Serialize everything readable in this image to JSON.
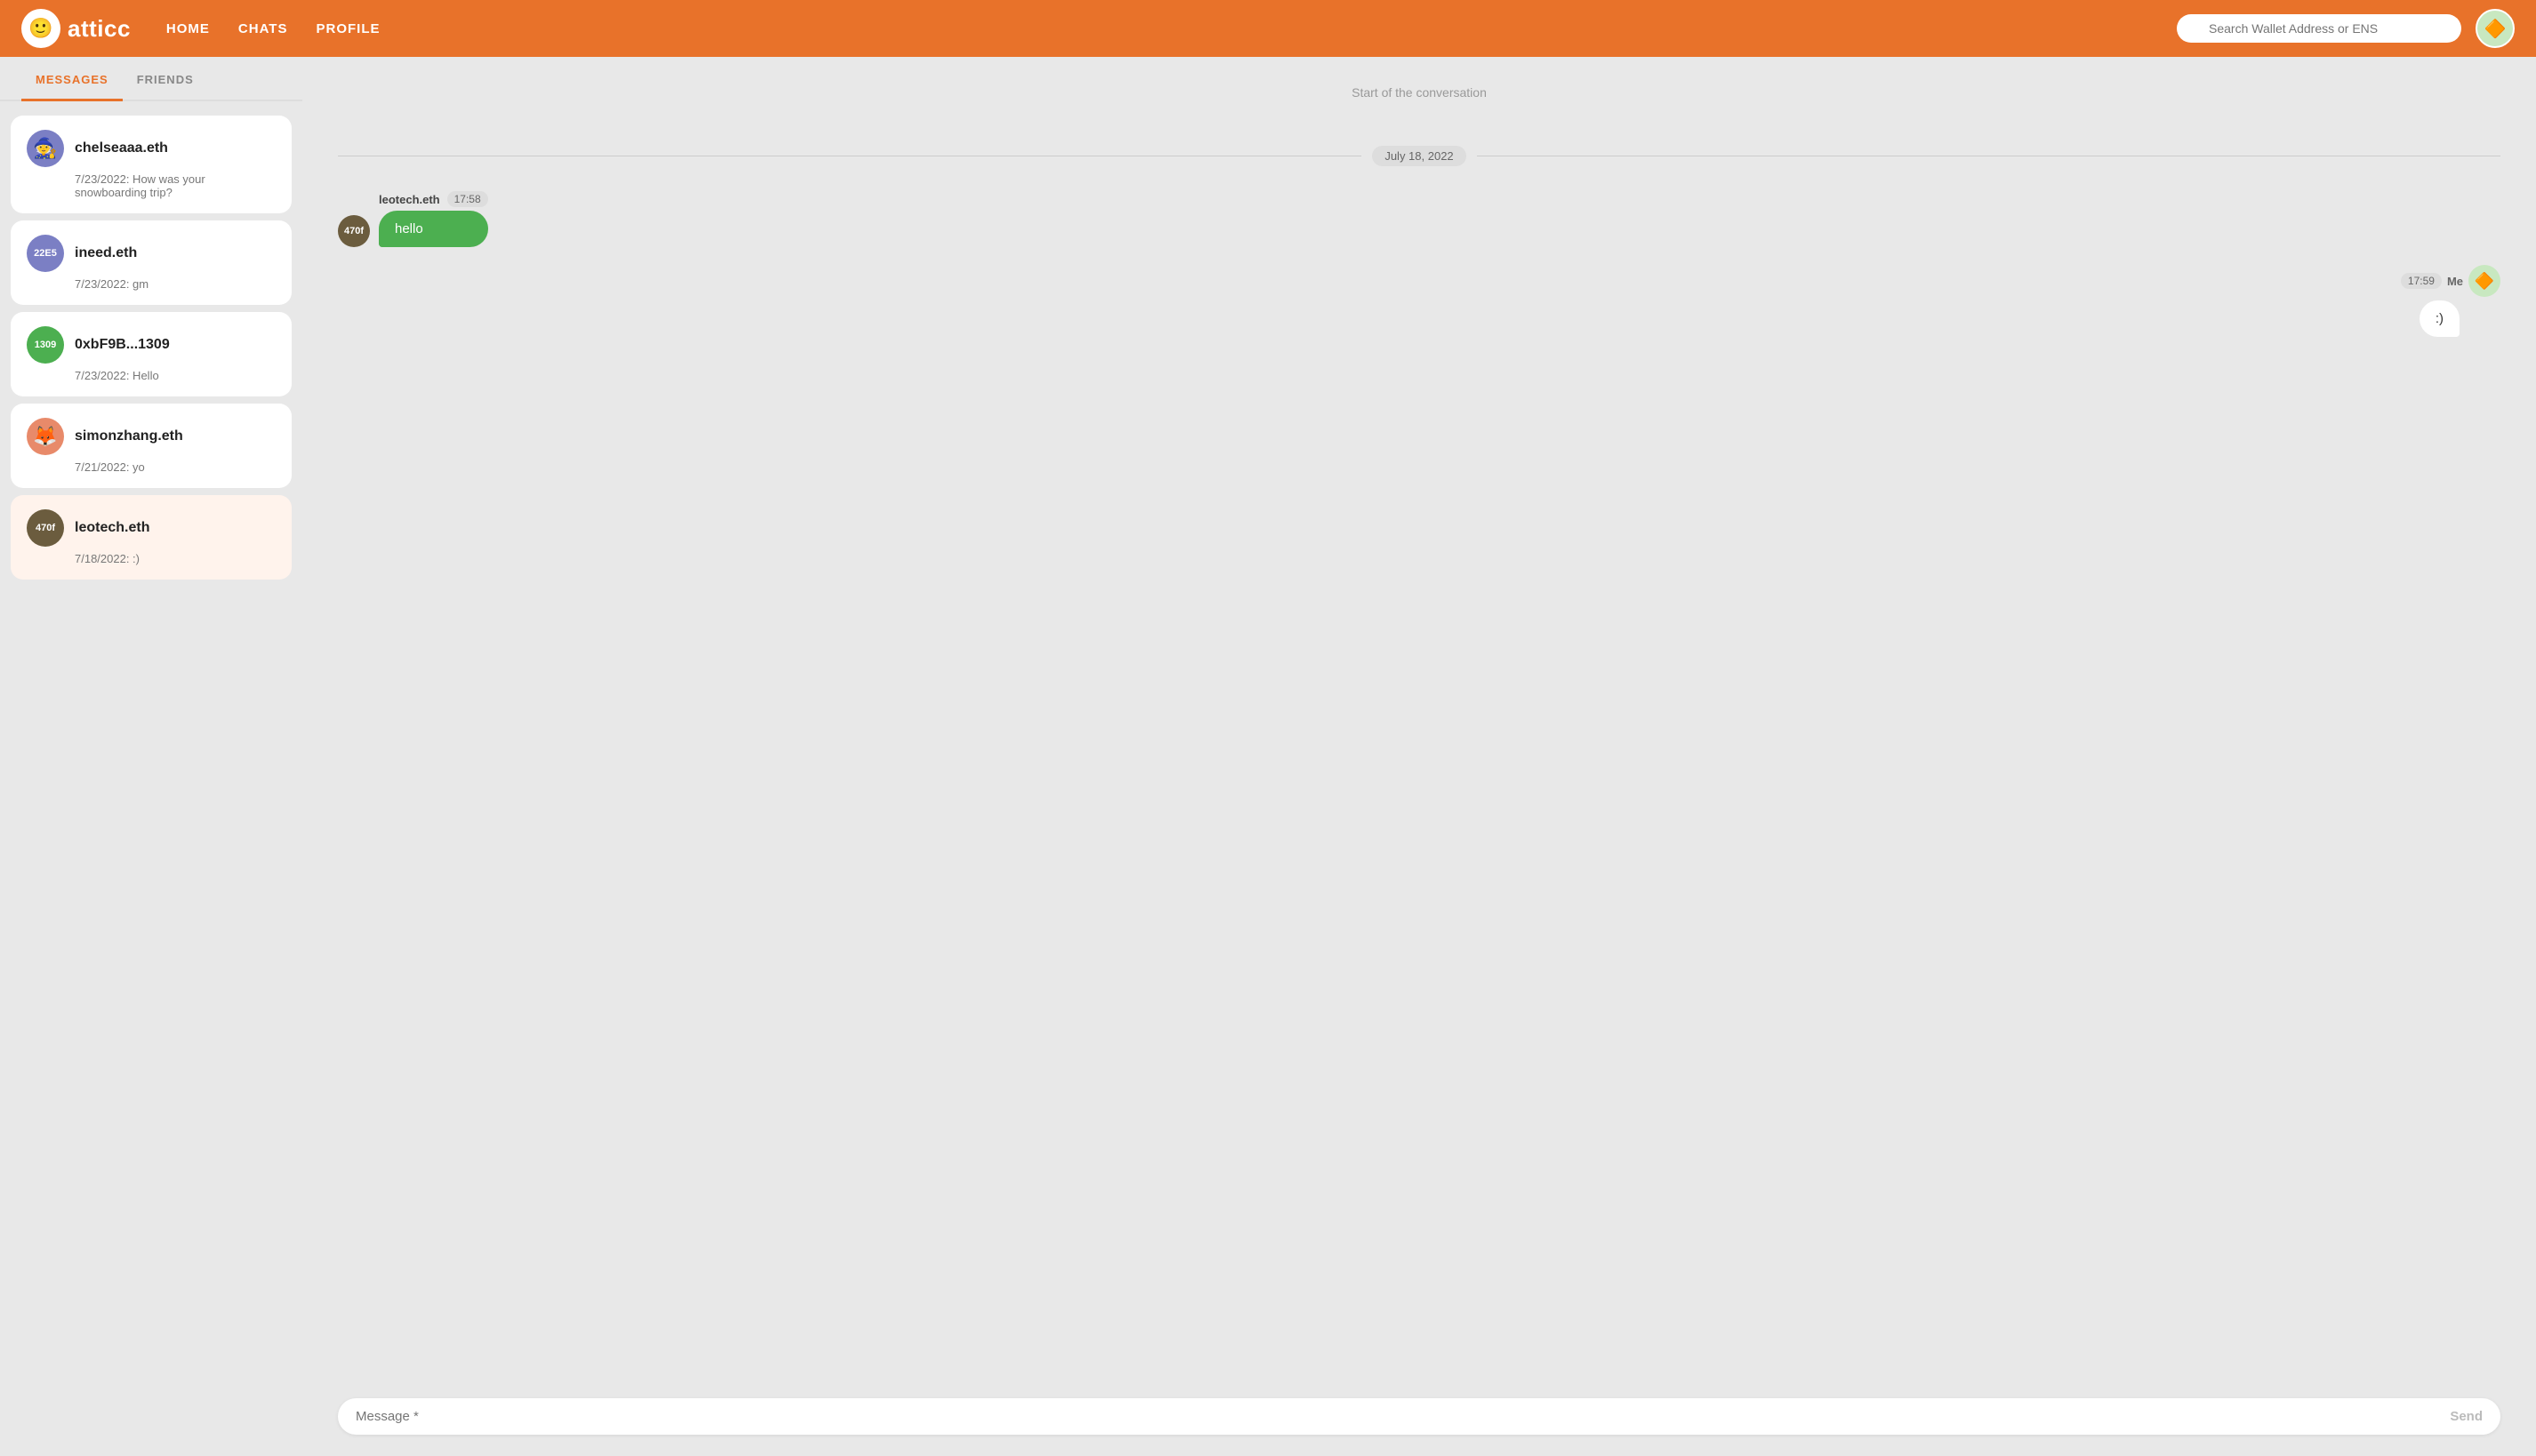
{
  "app": {
    "logo_icon": "🙂",
    "logo_text": "atticc"
  },
  "navbar": {
    "home_label": "HOME",
    "chats_label": "CHATS",
    "profile_label": "PROFILE",
    "search_placeholder": "Search Wallet Address or ENS",
    "user_avatar_icon": "🔶"
  },
  "tabs": {
    "messages_label": "MESSAGES",
    "friends_label": "FRIENDS"
  },
  "conversations": [
    {
      "id": "chelseaaa",
      "name": "chelseaaa.eth",
      "preview": "7/23/2022: How was your snowboarding trip?",
      "avatar_type": "image",
      "avatar_color": "#7b7fc4",
      "avatar_initials": "",
      "avatar_emoji": "🧙"
    },
    {
      "id": "ineed",
      "name": "ineed.eth",
      "preview": "7/23/2022: gm",
      "avatar_type": "initials",
      "avatar_color": "#7b7fc4",
      "avatar_initials": "22E5",
      "avatar_emoji": ""
    },
    {
      "id": "0xbF9B",
      "name": "0xbF9B...1309",
      "preview": "7/23/2022: Hello",
      "avatar_type": "initials",
      "avatar_color": "#4caf50",
      "avatar_initials": "1309",
      "avatar_emoji": ""
    },
    {
      "id": "simonzhang",
      "name": "simonzhang.eth",
      "preview": "7/21/2022: yo",
      "avatar_type": "image",
      "avatar_color": "#e88a6a",
      "avatar_initials": "",
      "avatar_emoji": "🦊"
    },
    {
      "id": "leotech",
      "name": "leotech.eth",
      "preview": "7/18/2022: :)",
      "avatar_type": "initials",
      "avatar_color": "#6b5c3e",
      "avatar_initials": "470f",
      "avatar_emoji": ""
    }
  ],
  "chat": {
    "conversation_start_label": "Start of the conversation",
    "date_divider_label": "July 18, 2022",
    "messages": [
      {
        "id": "msg1",
        "direction": "incoming",
        "sender_name": "leotech.eth",
        "time": "17:58",
        "avatar_initials": "470f",
        "avatar_color": "#6b5c3e",
        "text": "hello"
      },
      {
        "id": "msg2",
        "direction": "outgoing",
        "sender_name": "Me",
        "time": "17:59",
        "avatar_initials": "🔶",
        "avatar_color": "#c8e8c0",
        "text": ":)"
      }
    ],
    "input_placeholder": "Message *",
    "send_label": "Send"
  }
}
